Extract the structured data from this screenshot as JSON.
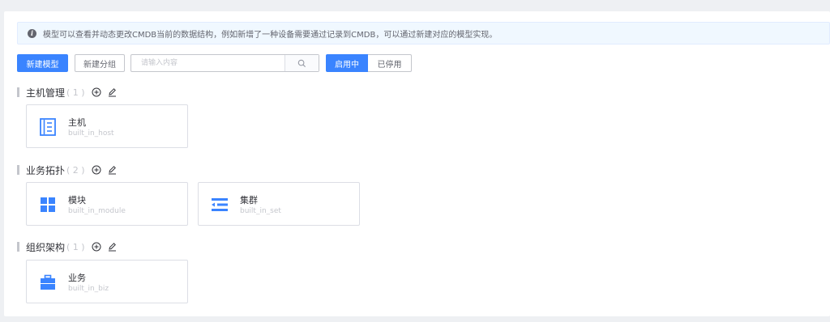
{
  "notice": {
    "text": "模型可以查看并动态更改CMDB当前的数据结构，例如新增了一种设备需要通过记录到CMDB，可以通过新建对应的模型实现。"
  },
  "toolbar": {
    "new_model_label": "新建模型",
    "new_group_label": "新建分组",
    "search_placeholder": "请输入内容",
    "toggle_enabled_label": "启用中",
    "toggle_disabled_label": "已停用"
  },
  "colors": {
    "accent": "#3a84ff",
    "icon_blue": "#3a84ff"
  },
  "groups": [
    {
      "name": "主机管理",
      "count": "( 1 )",
      "models": [
        {
          "name": "主机",
          "id": "built_in_host",
          "icon": "host-icon"
        }
      ]
    },
    {
      "name": "业务拓扑",
      "count": "( 2 )",
      "models": [
        {
          "name": "模块",
          "id": "built_in_module",
          "icon": "module-grid-icon"
        },
        {
          "name": "集群",
          "id": "built_in_set",
          "icon": "set-list-icon"
        }
      ]
    },
    {
      "name": "组织架构",
      "count": "( 1 )",
      "models": [
        {
          "name": "业务",
          "id": "built_in_biz",
          "icon": "briefcase-icon"
        }
      ]
    }
  ]
}
